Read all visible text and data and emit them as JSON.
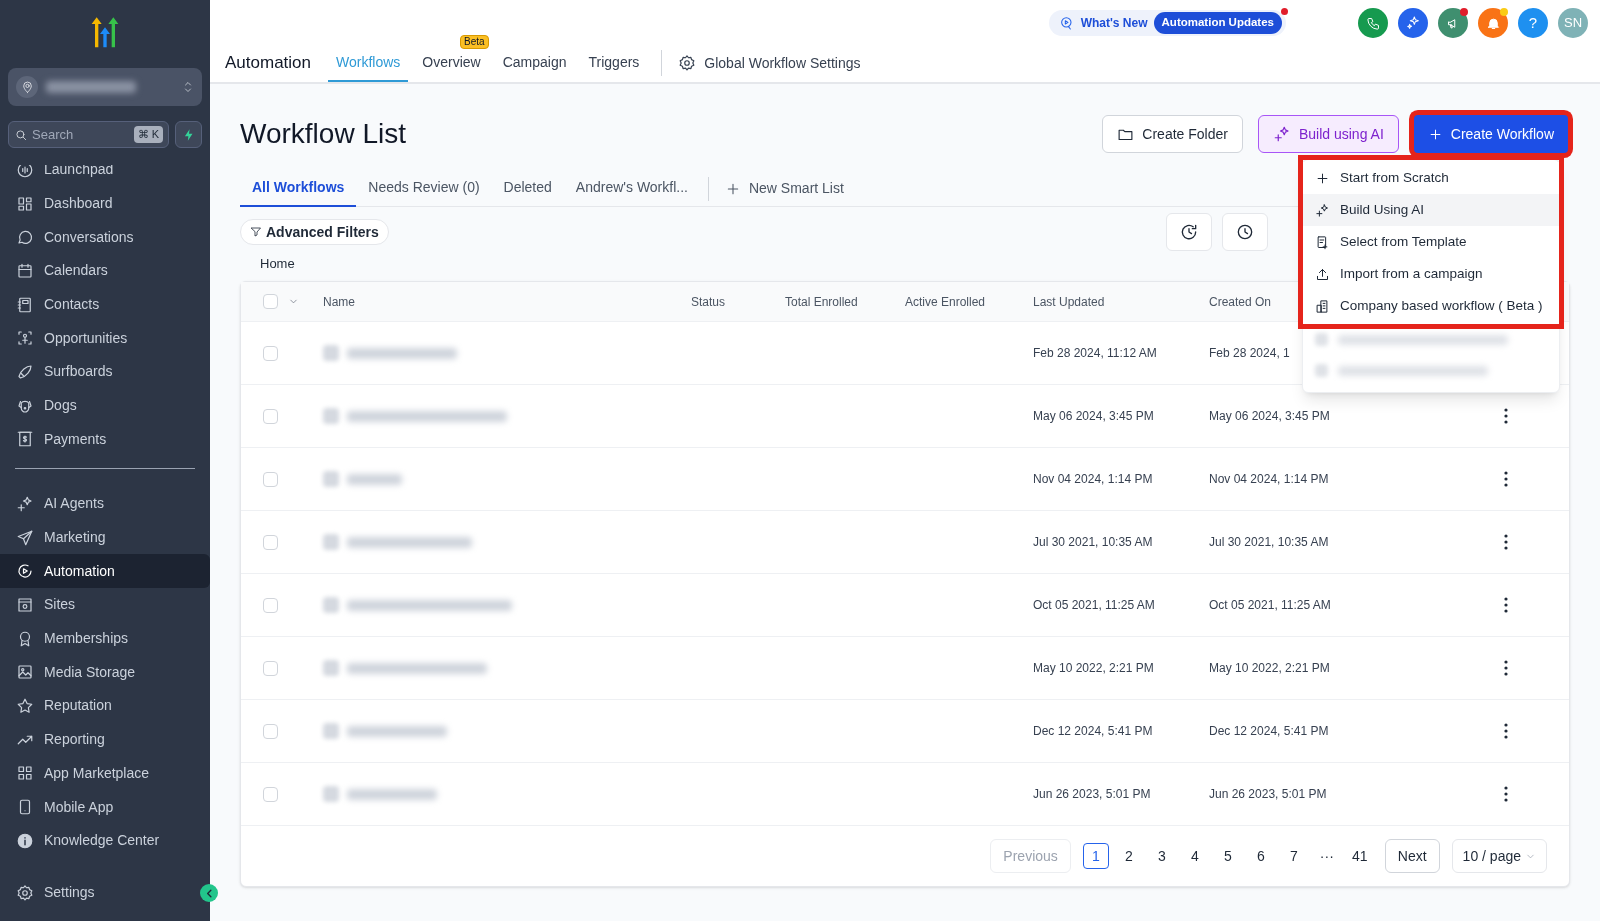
{
  "sidebar": {
    "search": {
      "placeholder": "Search",
      "shortcut": "⌘ K"
    },
    "items": [
      {
        "label": "Launchpad",
        "selected": false
      },
      {
        "label": "Dashboard",
        "selected": false
      },
      {
        "label": "Conversations",
        "selected": false
      },
      {
        "label": "Calendars",
        "selected": false
      },
      {
        "label": "Contacts",
        "selected": false
      },
      {
        "label": "Opportunities",
        "selected": false
      },
      {
        "label": "Surfboards",
        "selected": false
      },
      {
        "label": "Dogs",
        "selected": false
      },
      {
        "label": "Payments",
        "selected": false
      }
    ],
    "items_2": [
      {
        "label": "AI Agents",
        "selected": false
      },
      {
        "label": "Marketing",
        "selected": false
      },
      {
        "label": "Automation",
        "selected": true
      },
      {
        "label": "Sites",
        "selected": false
      },
      {
        "label": "Memberships",
        "selected": false
      },
      {
        "label": "Media Storage",
        "selected": false
      },
      {
        "label": "Reputation",
        "selected": false
      },
      {
        "label": "Reporting",
        "selected": false
      },
      {
        "label": "App Marketplace",
        "selected": false
      },
      {
        "label": "Mobile App",
        "selected": false
      },
      {
        "label": "Knowledge Center",
        "selected": false
      }
    ],
    "settings": "Settings"
  },
  "topbar": {
    "whats_new": "What's New",
    "updates_badge": "Automation Updates",
    "avatar": "SN",
    "help": "?"
  },
  "header": {
    "title": "Automation",
    "tabs": [
      {
        "label": "Workflows",
        "selected": true
      },
      {
        "label": "Overview",
        "selected": false,
        "badge": "Beta"
      },
      {
        "label": "Campaign",
        "selected": false
      },
      {
        "label": "Triggers",
        "selected": false
      }
    ],
    "settings_link": "Global Workflow Settings"
  },
  "page": {
    "title": "Workflow List",
    "buttons": {
      "create_folder": "Create Folder",
      "build_ai": "Build using AI",
      "create_workflow": "Create Workflow"
    },
    "list_tabs": [
      {
        "label": "All Workflows",
        "selected": true
      },
      {
        "label": "Needs Review (0)",
        "selected": false
      },
      {
        "label": "Deleted",
        "selected": false
      },
      {
        "label": "Andrew's Workfl...",
        "selected": false
      }
    ],
    "new_smart_list": "New Smart List",
    "advanced_filters": "Advanced Filters",
    "breadcrumb": "Home"
  },
  "dropdown": {
    "items": [
      {
        "label": "Start from Scratch",
        "hovered": false
      },
      {
        "label": "Build Using AI",
        "hovered": true
      },
      {
        "label": "Select from Template",
        "hovered": false
      },
      {
        "label": "Import from a campaign",
        "hovered": false
      },
      {
        "label": "Company based workflow ( Beta )",
        "hovered": false
      }
    ]
  },
  "table": {
    "select_all_checked": false,
    "columns": [
      "Name",
      "Status",
      "Total Enrolled",
      "Active Enrolled",
      "Last Updated",
      "Created On"
    ],
    "rows": [
      {
        "last_updated": "Feb 28 2024, 11:12 AM",
        "created_on": "Feb 28 2024, 1",
        "menu_visible": false,
        "checked": false
      },
      {
        "last_updated": "May 06 2024, 3:45 PM",
        "created_on": "May 06 2024, 3:45 PM",
        "menu_visible": true,
        "checked": false
      },
      {
        "last_updated": "Nov 04 2024, 1:14 PM",
        "created_on": "Nov 04 2024, 1:14 PM",
        "menu_visible": true,
        "checked": false
      },
      {
        "last_updated": "Jul 30 2021, 10:35 AM",
        "created_on": "Jul 30 2021, 10:35 AM",
        "menu_visible": true,
        "checked": false
      },
      {
        "last_updated": "Oct 05 2021, 11:25 AM",
        "created_on": "Oct 05 2021, 11:25 AM",
        "menu_visible": true,
        "checked": false
      },
      {
        "last_updated": "May 10 2022, 2:21 PM",
        "created_on": "May 10 2022, 2:21 PM",
        "menu_visible": true,
        "checked": false
      },
      {
        "last_updated": "Dec 12 2024, 5:41 PM",
        "created_on": "Dec 12 2024, 5:41 PM",
        "menu_visible": true,
        "checked": false
      },
      {
        "last_updated": "Jun 26 2023, 5:01 PM",
        "created_on": "Jun 26 2023, 5:01 PM",
        "menu_visible": true,
        "checked": false
      }
    ]
  },
  "pagination": {
    "previous": {
      "label": "Previous",
      "disabled": true
    },
    "pages": [
      {
        "label": "1",
        "selected": true
      },
      {
        "label": "2",
        "selected": false
      },
      {
        "label": "3",
        "selected": false
      },
      {
        "label": "4",
        "selected": false
      },
      {
        "label": "5",
        "selected": false
      },
      {
        "label": "6",
        "selected": false
      },
      {
        "label": "7",
        "selected": false
      },
      {
        "label": "···",
        "selected": false
      },
      {
        "label": "41",
        "selected": false
      }
    ],
    "next": {
      "label": "Next",
      "disabled": false
    },
    "page_size": "10 / page"
  }
}
